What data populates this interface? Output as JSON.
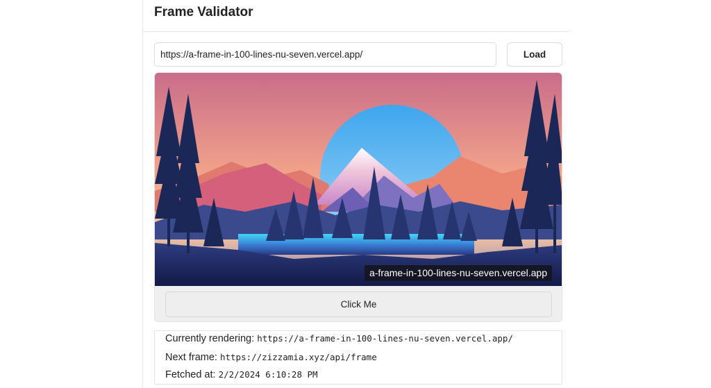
{
  "header": {
    "title": "Frame Validator"
  },
  "url_bar": {
    "value": "https://a-frame-in-100-lines-nu-seven.vercel.app/",
    "load_label": "Load"
  },
  "frame": {
    "image_description_icon": "landscape-sunset-mountains-trees",
    "domain_badge": "a-frame-in-100-lines-nu-seven.vercel.app",
    "button_label": "Click Me"
  },
  "info": {
    "currently_rendering_label": "Currently rendering:",
    "currently_rendering_value": "https://a-frame-in-100-lines-nu-seven.vercel.app/",
    "next_frame_label": "Next frame:",
    "next_frame_value": "https://zizzamia.xyz/api/frame",
    "fetched_at_label": "Fetched at:",
    "fetched_at_value": "2/2/2024 6:10:28 PM"
  }
}
